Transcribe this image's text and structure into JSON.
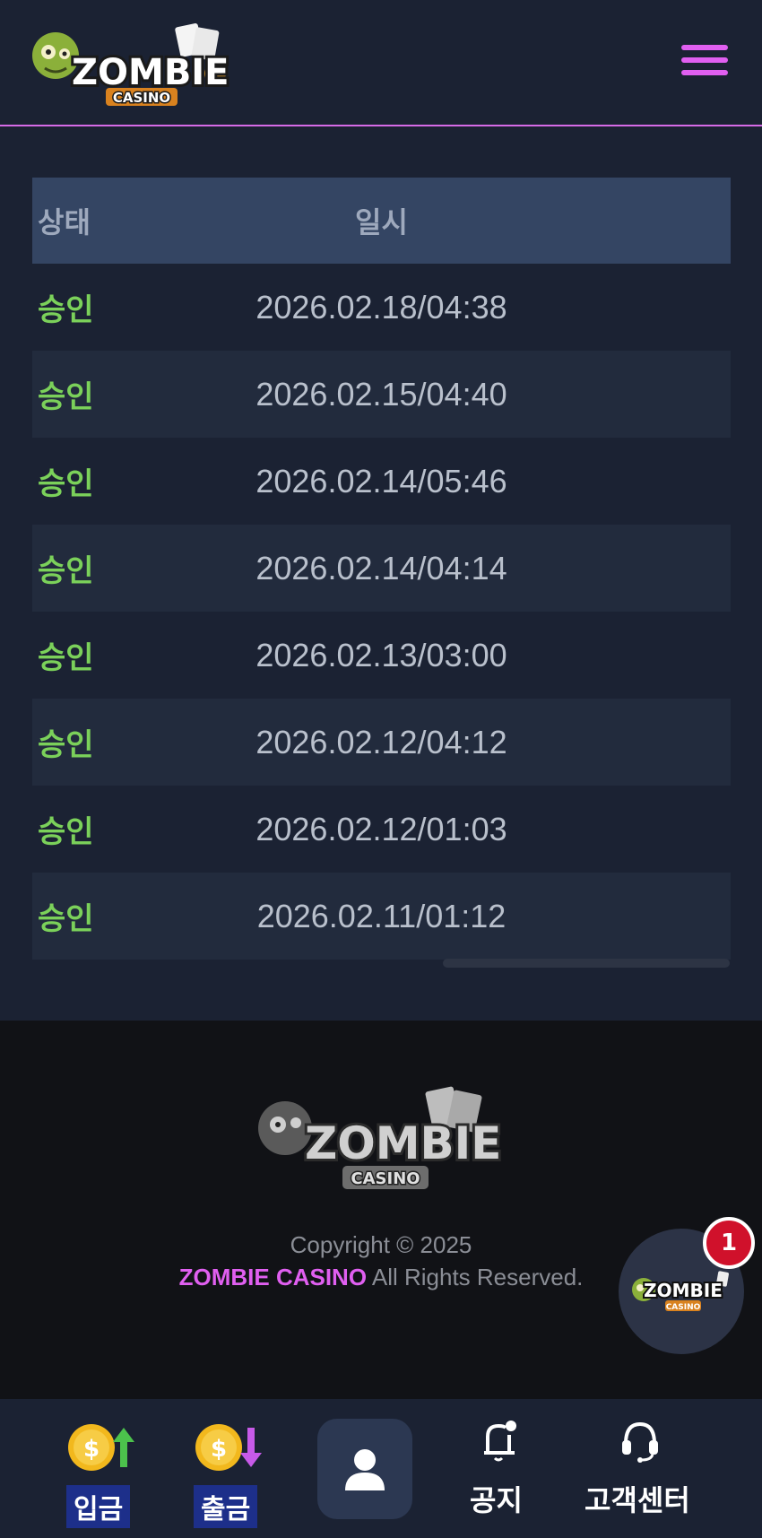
{
  "header": {
    "logo_main": "ZOMBIE",
    "logo_sub": "CASINO"
  },
  "table": {
    "columns": [
      "상태",
      "일시"
    ],
    "rows": [
      {
        "status": "승인",
        "datetime": "2026.02.18/04:38"
      },
      {
        "status": "승인",
        "datetime": "2026.02.15/04:40"
      },
      {
        "status": "승인",
        "datetime": "2026.02.14/05:46"
      },
      {
        "status": "승인",
        "datetime": "2026.02.14/04:14"
      },
      {
        "status": "승인",
        "datetime": "2026.02.13/03:00"
      },
      {
        "status": "승인",
        "datetime": "2026.02.12/04:12"
      },
      {
        "status": "승인",
        "datetime": "2026.02.12/01:03"
      },
      {
        "status": "승인",
        "datetime": "2026.02.11/01:12"
      }
    ]
  },
  "footer": {
    "logo_main": "ZOMBIE",
    "logo_sub": "CASINO",
    "copyright_line1": "Copyright © 2025",
    "brand": "ZOMBIE CASINO",
    "rights": " All Rights Reserved."
  },
  "float_chat": {
    "badge_count": "1",
    "logo_main": "ZOMBIE",
    "logo_sub": "CASINO"
  },
  "bottom_nav": {
    "deposit": "입금",
    "withdraw": "출금",
    "notice": "공지",
    "support": "고객센터"
  },
  "colors": {
    "accent": "#e05ff0",
    "status_approved": "#7bd15a",
    "header_row": "#344563",
    "background": "#1b2233"
  },
  "icons": [
    "menu-icon",
    "user-icon",
    "bell-icon",
    "headset-icon",
    "coin-up-icon",
    "coin-down-icon"
  ]
}
